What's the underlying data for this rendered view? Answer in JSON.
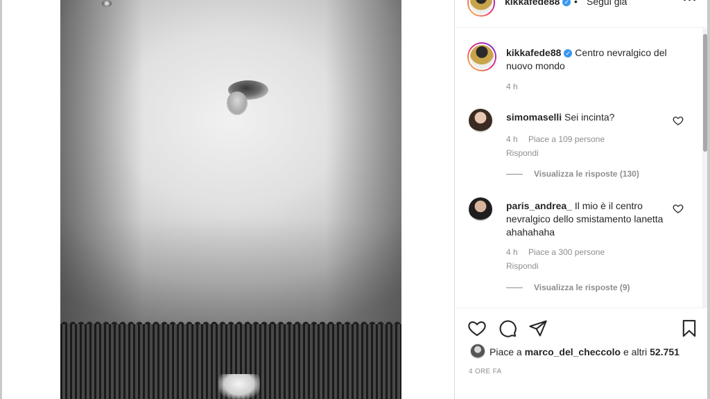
{
  "header": {
    "username": "kikkafede88",
    "separator": "•",
    "follow_status": "Segui già",
    "more": "···"
  },
  "caption": {
    "username": "kikkafede88",
    "text": "Centro nevralgico del nuovo mondo",
    "time": "4 h"
  },
  "comments": [
    {
      "username": "simomaselli",
      "text": "Sei incinta?",
      "time": "4 h",
      "likes": "Piace a 109 persone",
      "reply": "Rispondi",
      "view_replies": "Visualizza le risposte (130)"
    },
    {
      "username": "paris_andrea_",
      "text": "Il mio è il centro nevralgico dello smistamento lanetta ahahahaha",
      "time": "4 h",
      "likes": "Piace a 300 persone",
      "reply": "Rispondi",
      "view_replies": "Visualizza le risposte (9)"
    }
  ],
  "likes": {
    "prefix": "Piace a",
    "user": "marco_del_checcolo",
    "suffix": "e altri",
    "count": "52.751"
  },
  "post_time": "4 ORE FA",
  "colors": {
    "text": "#262626",
    "secondary": "#8e8e8e",
    "verified": "#3897f0",
    "divider": "#efefef"
  },
  "icons": {
    "like": "heart-icon",
    "comment": "comment-bubble-icon",
    "share": "paper-plane-icon",
    "save": "bookmark-icon",
    "verified": "verified-badge-icon",
    "more": "more-dots-icon"
  }
}
